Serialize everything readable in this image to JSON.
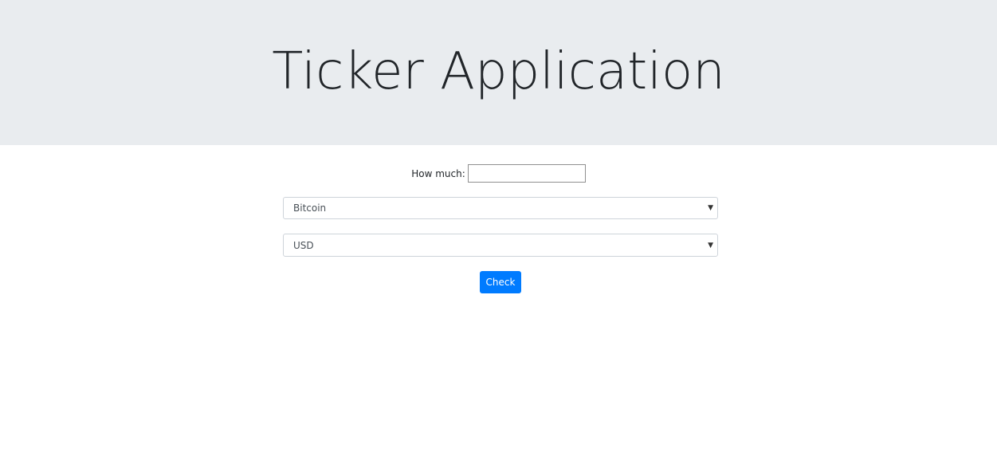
{
  "header": {
    "title": "Ticker Application"
  },
  "form": {
    "amount_label": "How much:",
    "amount_value": "",
    "crypto_select": {
      "selected": "Bitcoin"
    },
    "currency_select": {
      "selected": "USD"
    },
    "check_button_label": "Check"
  },
  "icons": {
    "select_arrow": "chevron-down-icon"
  },
  "colors": {
    "header_background": "#e9ecef",
    "primary_button": "#007bff"
  }
}
